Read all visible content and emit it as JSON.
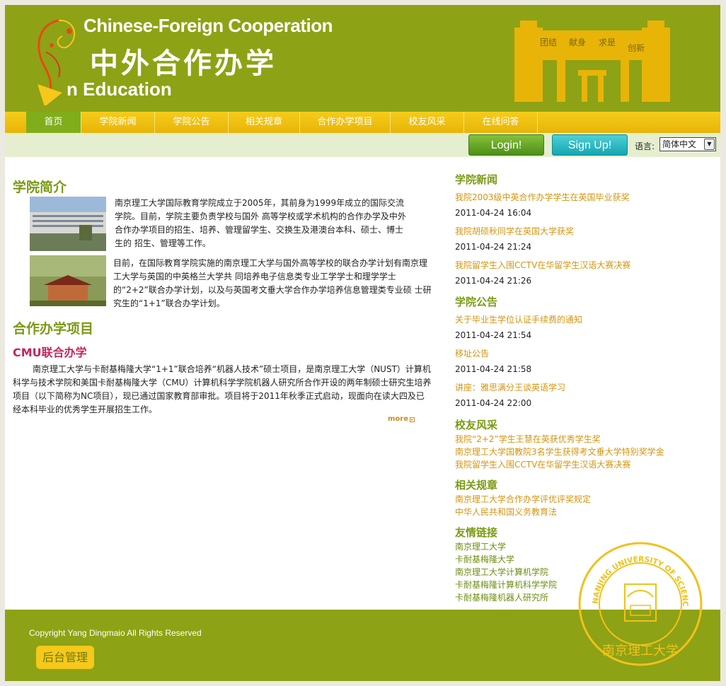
{
  "header": {
    "title_en": "Chinese-Foreign Cooperation",
    "title_cn": "中外合作办学",
    "subtitle_en": "n Education",
    "gate_words": [
      "团结",
      "献身",
      "求是",
      "创新"
    ]
  },
  "nav": {
    "items": [
      {
        "label": "首页"
      },
      {
        "label": "学院新闻"
      },
      {
        "label": "学院公告"
      },
      {
        "label": "相关规章"
      },
      {
        "label": "合作办学项目"
      },
      {
        "label": "校友风采"
      },
      {
        "label": "在线问答"
      }
    ]
  },
  "loginbar": {
    "login_label": "Login!",
    "signup_label": "Sign Up!",
    "lang_label": "语言:",
    "lang_selected": "简体中文"
  },
  "intro": {
    "heading": "学院简介",
    "para1_lines": [
      "南京理工大学国际教育学院成立于2005年，其前身为1999年成立的国际交流",
      "学院。目前，学院主要负责学校与国外 高等学校或学术机构的合作办学及中外",
      "合作办学项目的招生、培养、管理留学生、交换生及港澳台本科、硕士、博士",
      "生的 招生、管理等工作。"
    ],
    "para2_lines": [
      "目前，在国际教育学院实施的南京理工大学与国外高等学校的联合办学计划有南京理",
      "工大学与英国的中英格兰大学共 同培养电子信息类专业工学学士和理学学士",
      "的“2+2”联合办学计划，以及与英国考文垂大学合作办学培养信息管理类专业硕 士研",
      "究生的“1+1”联合办学计划。"
    ]
  },
  "projects": {
    "heading": "合作办学项目",
    "subheading": "CMU联合办学",
    "text_lines": [
      "南京理工大学与卡耐基梅隆大学“1+1”联合培养“机器人技术”硕士项目，是南京理工大学（NUST）计算机",
      "科学与技术学院和美国卡耐基梅隆大学（CMU）计算机科学学院机器人研究所合作开设的两年制硕士研究生培养",
      "项目（以下简称为NC项目），现已通过国家教育部审批。项目将于2011年秋季正式启动，现面向在读大四及已",
      "经本科毕业的优秀学生开展招生工作。"
    ],
    "more_label": "more"
  },
  "news": {
    "heading": "学院新闻",
    "items": [
      {
        "title": "我院2003级中英合作办学学生在英国毕业获奖",
        "date": "2011-04-24 16:04"
      },
      {
        "title": "我院胡硕秋同学在英国大学获奖",
        "date": "2011-04-24 21:24"
      },
      {
        "title": "我院留学生入围CCTV在华留学生汉语大赛决赛",
        "date": "2011-04-24 21:26"
      }
    ]
  },
  "notices": {
    "heading": "学院公告",
    "items": [
      {
        "title": "关于毕业生学位认证手续费的通知",
        "date": "2011-04-24 21:54"
      },
      {
        "title": "移址公告",
        "date": "2011-04-24 21:58"
      },
      {
        "title": "讲座：雅思满分王谈英语学习",
        "date": "2011-04-24 22:00"
      }
    ]
  },
  "alumni": {
    "heading": "校友风采",
    "items": [
      "我院“2+2”学生王慧在英获优秀学生奖",
      "南京理工大学国教院3名学生获得考文垂大学特别奖学金",
      "我院留学生入围CCTV在华留学生汉语大赛决赛"
    ]
  },
  "regulations": {
    "heading": "相关规章",
    "items": [
      "南京理工大学合作办学评优评奖规定",
      "中华人民共和国义务教育法"
    ]
  },
  "links": {
    "heading": "友情链接",
    "items": [
      "南京理工大学",
      "卡耐基梅隆大学",
      "南京理工大学计算机学院",
      "卡耐基梅隆计算机科学学院",
      "卡耐基梅隆机器人研究所"
    ]
  },
  "footer": {
    "copyright": "Copyright Yang Dingmaio All Rights Reserved",
    "admin_label": "后台管理",
    "seal_text": "NANJING UNIVERSITY OF SCIENCE & TECHNOLOGY",
    "seal_cn": "南京理工大学"
  },
  "colors": {
    "header_green": "#8ea215",
    "nav_yellow": "#f0c010",
    "nav_active": "#7fae1a",
    "heading_green": "#7a9a14",
    "link_orange": "#d6940f",
    "subheading_red": "#c4265a"
  }
}
